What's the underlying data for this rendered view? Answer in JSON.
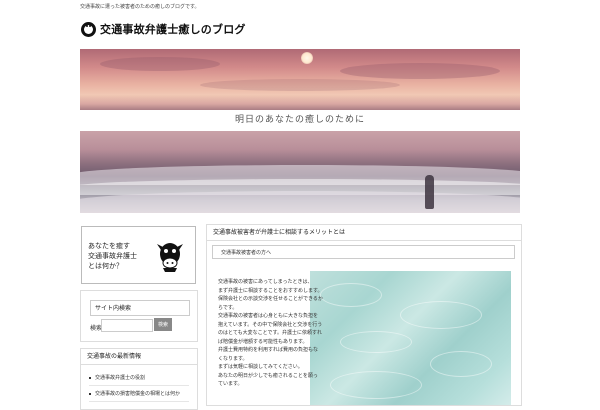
{
  "site": {
    "tagline": "交通事故に遭った被害者のための癒しのブログです。",
    "title": "交通事故弁護士癒しのブログ",
    "motto": "明日のあなたの癒しのために"
  },
  "sidebar": {
    "profile": {
      "line1": "あなたを癒す",
      "line2": "交通事故弁護士",
      "line3": "とは何か？"
    },
    "search": {
      "title": "サイト内検索",
      "label": "検索",
      "placeholder": "",
      "button": "検索"
    },
    "categories": {
      "title": "交通事故の最新情報",
      "items": [
        {
          "label": "交通事故弁護士の役割"
        },
        {
          "label": "交通事故の損害賠償金の相場とは何か"
        }
      ]
    }
  },
  "post": {
    "title": "交通事故被害者が弁護士に相談するメリットとは",
    "subtitle": "交通事故被害者の方へ",
    "paragraphs": [
      "交通事故の被害にあってしまったときは、",
      "まず弁護士に相談することをおすすめします。",
      "保険会社との示談交渉を任せることができるか",
      "らです。",
      "交通事故の被害者は心身ともに大きな負担を",
      "抱えています。その中で保険会社と交渉を行う",
      "のはとても大変なことです。弁護士に依頼すれ",
      "ば賠償金が増額する可能性もあります。",
      "弁護士費用特約を利用すれば費用の負担もな",
      "くなります。",
      "まずは気軽に相談してみてください。",
      "あなたの明日が少しでも癒されることを願っ",
      "ています。"
    ]
  },
  "colors": {
    "sunset_sky": "#d28a8a",
    "sea": "#6d5b6d",
    "pool": "#a8d6d1",
    "search_button": "#888888"
  },
  "icons": {
    "logo": "smiling-face-icon",
    "mascot": "cow-icon"
  }
}
